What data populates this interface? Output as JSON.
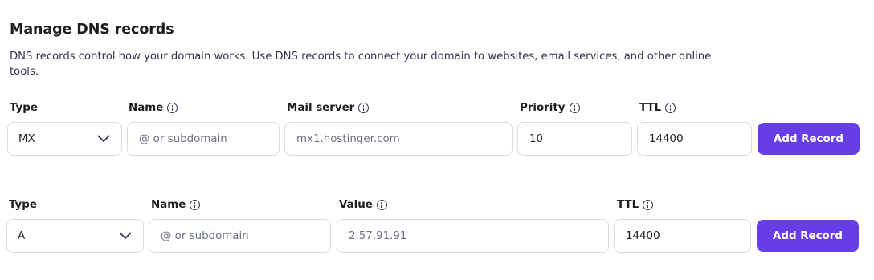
{
  "header": {
    "title": "Manage DNS records",
    "description": "DNS records control how your domain works. Use DNS records to connect your domain to websites, email services, and other online tools."
  },
  "mx_form": {
    "type_label": "Type",
    "type_value": "MX",
    "name_label": "Name",
    "name_placeholder": "@ or subdomain",
    "mail_server_label": "Mail server",
    "mail_server_placeholder": "mx1.hostinger.com",
    "priority_label": "Priority",
    "priority_value": "10",
    "ttl_label": "TTL",
    "ttl_value": "14400",
    "add_button": "Add Record"
  },
  "a_form": {
    "type_label": "Type",
    "type_value": "A",
    "name_label": "Name",
    "name_placeholder": "@ or subdomain",
    "value_label": "Value",
    "value_placeholder": "2.57.91.91",
    "ttl_label": "TTL",
    "ttl_value": "14400",
    "add_button": "Add Record"
  },
  "icons": [
    "info-icon",
    "chevron-down-icon"
  ],
  "colors": {
    "accent": "#673de6",
    "border": "#dadce0",
    "text": "#1d1e20",
    "placeholder": "#6d7081"
  }
}
